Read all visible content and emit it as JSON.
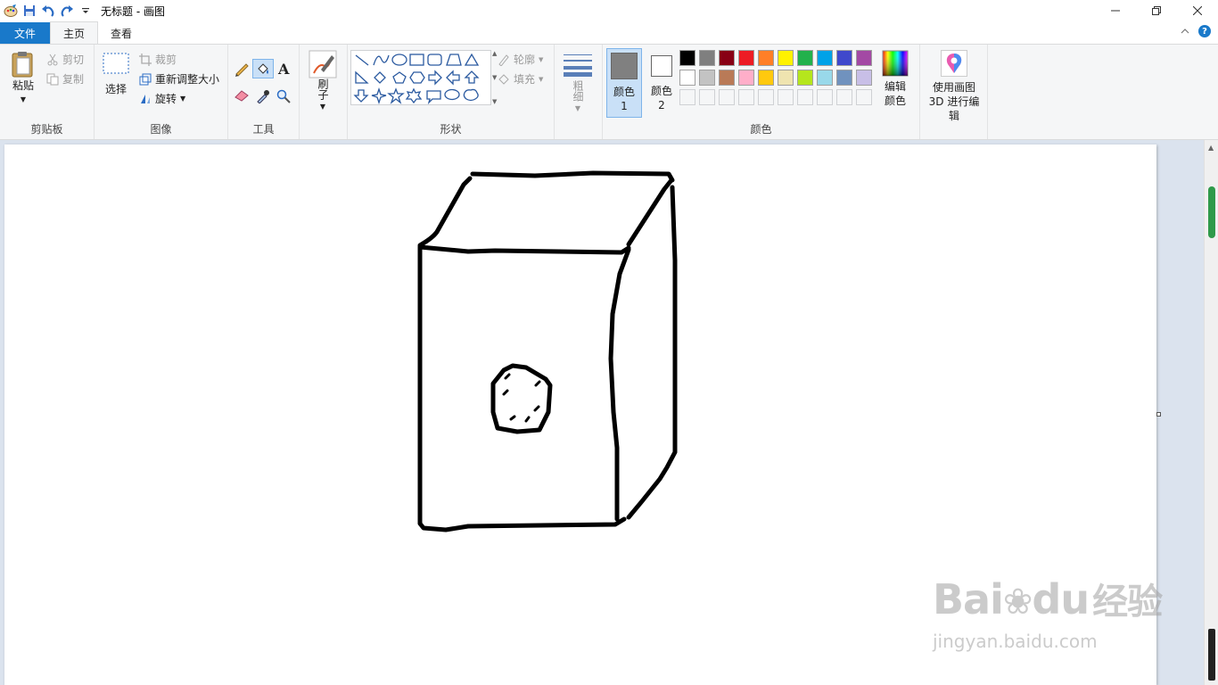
{
  "window": {
    "title": "无标题 - 画图"
  },
  "menu_tabs": [
    {
      "label": "文件"
    },
    {
      "label": "主页"
    },
    {
      "label": "查看"
    }
  ],
  "clipboard": {
    "paste": "粘贴",
    "cut": "剪切",
    "copy": "复制",
    "group": "剪贴板"
  },
  "image": {
    "select": "选择",
    "crop": "裁剪",
    "resize": "重新调整大小",
    "rotate": "旋转",
    "group": "图像"
  },
  "tools": {
    "group": "工具"
  },
  "brush": {
    "label": "刷子"
  },
  "shapes": {
    "outline": "轮廓",
    "fill": "填充",
    "group": "形状"
  },
  "size": {
    "label": "粗细"
  },
  "colors": {
    "color1_label": "颜色 1",
    "color2_label": "颜色 2",
    "color1": "#808080",
    "color2": "#ffffff",
    "edit_colors": "编辑颜色",
    "group": "颜色",
    "palette_row1": [
      "#000000",
      "#7f7f7f",
      "#880015",
      "#ed1c24",
      "#ff7f27",
      "#fff200",
      "#22b14c",
      "#00a2e8",
      "#3f48cc",
      "#a349a4"
    ],
    "palette_row2": [
      "#ffffff",
      "#c3c3c3",
      "#b97a57",
      "#ffaec9",
      "#ffc90e",
      "#efe4b0",
      "#b5e61d",
      "#99d9ea",
      "#7092be",
      "#c8bfe7"
    ]
  },
  "paint3d": {
    "label": "使用画图 3D 进行编辑"
  },
  "watermark": {
    "brand": "Bai",
    "brand2": "du",
    "site_cn": "经验",
    "url": "jingyan.baidu.com"
  }
}
